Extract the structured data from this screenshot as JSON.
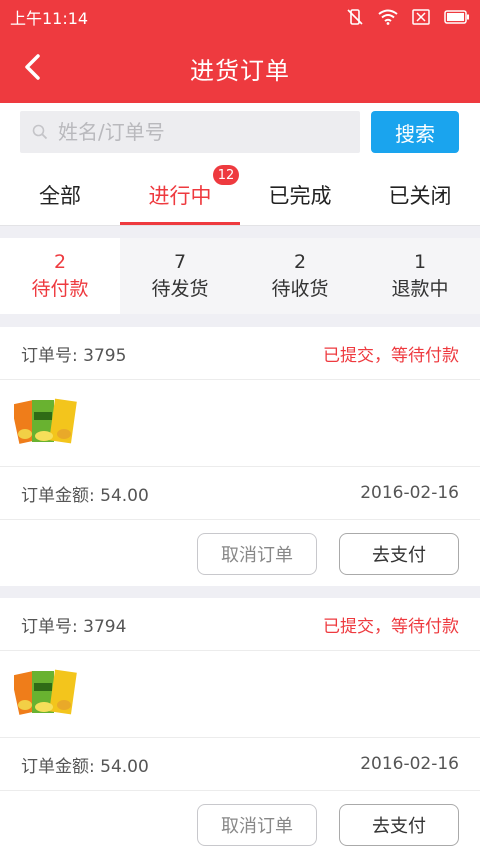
{
  "statusbar": {
    "time": "上午11:14"
  },
  "header": {
    "title": "进货订单"
  },
  "search": {
    "placeholder": "姓名/订单号",
    "button": "搜索"
  },
  "tabs": [
    {
      "label": "全部"
    },
    {
      "label": "进行中",
      "badge": "12"
    },
    {
      "label": "已完成"
    },
    {
      "label": "已关闭"
    }
  ],
  "substats": [
    {
      "count": "2",
      "label": "待付款"
    },
    {
      "count": "7",
      "label": "待发货"
    },
    {
      "count": "2",
      "label": "待收货"
    },
    {
      "count": "1",
      "label": "退款中"
    }
  ],
  "orders": [
    {
      "order_no": "订单号: 3795",
      "status": "已提交，等待付款",
      "amount": "订单金额: 54.00",
      "date": "2016-02-16",
      "cancel_label": "取消订单",
      "pay_label": "去支付"
    },
    {
      "order_no": "订单号: 3794",
      "status": "已提交，等待付款",
      "amount": "订单金额: 54.00",
      "date": "2016-02-16",
      "cancel_label": "取消订单",
      "pay_label": "去支付"
    }
  ],
  "colors": {
    "brand_red": "#ee3a3f",
    "search_blue": "#1aa4ee"
  }
}
